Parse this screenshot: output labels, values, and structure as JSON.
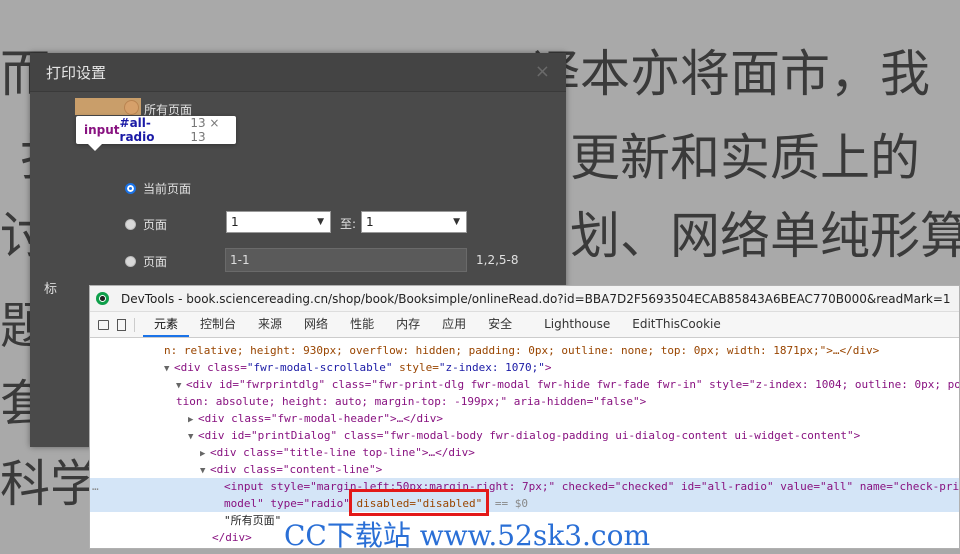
{
  "background_text": {
    "line1": "而",
    "line1b": "译本亦将面市，我",
    "line2": "打",
    "line2b": "更新和实质上的",
    "line3": "讨析",
    "line3b": "划、网络单纯形算",
    "line4": "题",
    "line5": "套码",
    "line6": "科学的"
  },
  "dialog": {
    "title": "打印设置",
    "close": "×",
    "options": [
      {
        "label": "所有页面"
      },
      {
        "label": "当前页面"
      },
      {
        "label": "页面"
      },
      {
        "label": "页面"
      }
    ],
    "range_from": "1",
    "range_to_label": "至:",
    "range_to": "1",
    "custom_pages_value": "1-1",
    "custom_pages_hint": "1,2,5-8",
    "side_label": "标"
  },
  "tooltip": {
    "tag": "input",
    "id": "#all-radio",
    "size": "13 × 13"
  },
  "devtools": {
    "title": "DevTools - book.sciencereading.cn/shop/book/Booksimple/onlineRead.do?id=BBA7D2F5693504ECAB85843A6BEAC770B000&readMark=1",
    "tabs": [
      "元素",
      "控制台",
      "来源",
      "网络",
      "性能",
      "内存",
      "应用",
      "安全",
      "Lighthouse",
      "EditThisCookie"
    ],
    "code": {
      "l1": "n: relative; height: 930px; overflow: hidden; padding: 0px; outline: none; top: 0px; width: 1871px;\">…</div>",
      "l2_tag": "<div class=",
      "l2_val": "\"fwr-modal-scrollable\"",
      "l2_attr": " style=",
      "l2_val2": "\"z-index: 1070;\"",
      "l2_end": ">",
      "l3": "<div id=\"fwrprintdlg\" class=\"fwr-print-dlg fwr-modal fwr-hide fwr-fade fwr-in\" style=\"z-index: 1004; outline: 0px; pos",
      "l4": "tion: absolute; height: auto; margin-top: -199px;\" aria-hidden=\"false\">",
      "l5": "<div class=\"fwr-modal-header\">…</div>",
      "l6": "<div id=\"printDialog\" class=\"fwr-modal-body fwr-dialog-padding ui-dialog-content ui-widget-content\">",
      "l7": "<div class=\"title-line top-line\">…</div>",
      "l8": "<div class=\"content-line\">",
      "l9": "<input style=\"margin-left:50px;margin-right: 7px;\" checked=\"checked\" id=\"all-radio\" value=\"all\" name=\"check-prin",
      "l10a": "model\" type=\"radio\" ",
      "l10b": "disabled=\"disabled\"",
      "l10c": "== $0",
      "l11": "\"所有页面\"",
      "l12": "</div>",
      "dots": "…"
    }
  },
  "watermark": "CC下载站 www.52sk3.com"
}
